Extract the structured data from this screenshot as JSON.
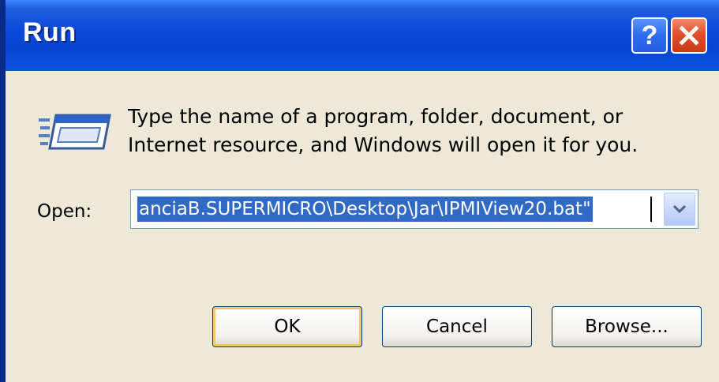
{
  "window": {
    "title": "Run",
    "help_label": "?",
    "accent_color": "#0a47d6",
    "close_color": "#e0502a"
  },
  "dialog": {
    "description_line1": "Type the name of a program, folder, document, or",
    "description_line2": "Internet resource, and Windows will open it for you.",
    "icon": "run-program-icon",
    "open_label": "Open:",
    "open_value": "anciaB.SUPERMICRO\\Desktop\\Jar\\IPMIView20.bat\"",
    "dropdown_icon": "chevron-down-icon"
  },
  "buttons": {
    "ok": "OK",
    "cancel": "Cancel",
    "browse": "Browse..."
  }
}
